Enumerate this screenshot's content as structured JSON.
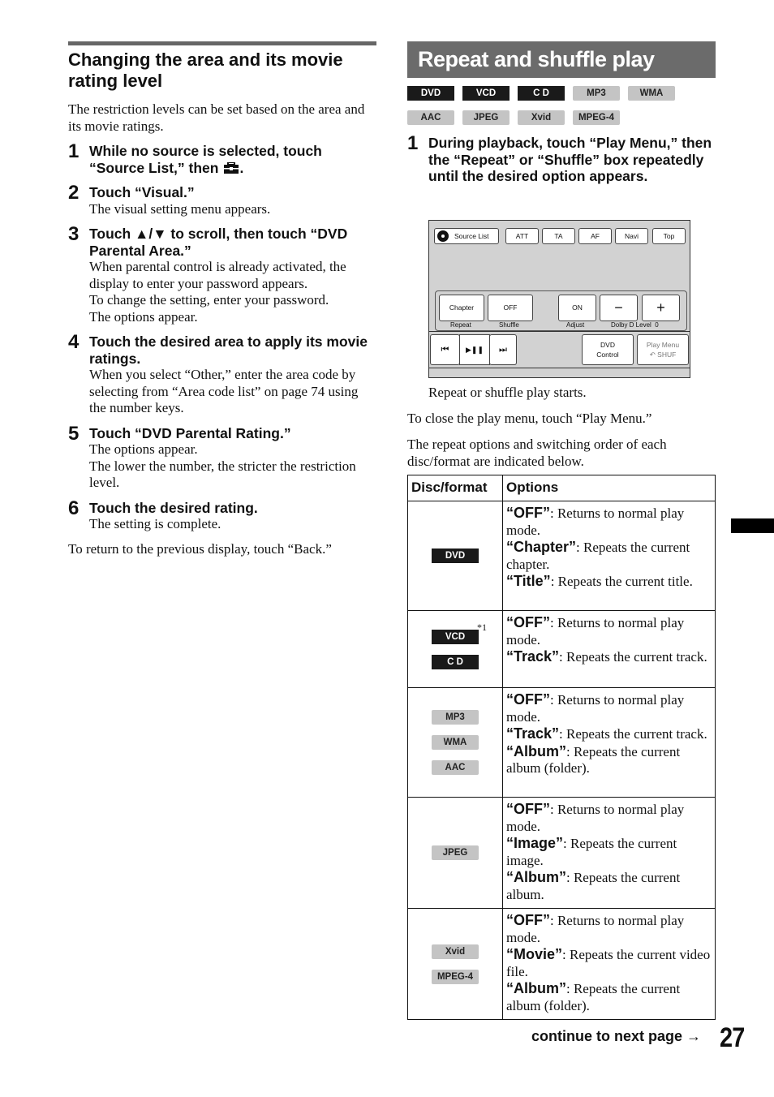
{
  "left": {
    "title": "Changing the area and its movie rating level",
    "intro": "The restriction levels can be set based on the area and its movie ratings.",
    "steps": [
      {
        "num": "1",
        "title": "While no source is selected, touch “Source List,” then",
        "title_icon": "toolbox-icon",
        "title_end": ".",
        "body": []
      },
      {
        "num": "2",
        "title": "Touch “Visual.”",
        "body": [
          "The visual setting menu appears."
        ]
      },
      {
        "num": "3",
        "title": "Touch ▲/▼ to scroll, then touch “DVD Parental Area.”",
        "body": [
          "When parental control is already activated, the display to enter your password appears.",
          "To change the setting, enter your password.",
          "The options appear."
        ]
      },
      {
        "num": "4",
        "title": "Touch the desired area to apply its movie ratings.",
        "body": [
          "When you select “Other,” enter the area code by selecting from “Area code list” on page 74 using the number keys."
        ]
      },
      {
        "num": "5",
        "title": "Touch “DVD Parental Rating.”",
        "body": [
          "The options appear.",
          "The lower the number, the stricter the restriction level."
        ]
      },
      {
        "num": "6",
        "title": "Touch the desired rating.",
        "body": [
          "The setting is complete."
        ]
      }
    ],
    "note": "To return to the previous display, touch “Back.”"
  },
  "right": {
    "banner": "Repeat and shuffle play",
    "badges": [
      {
        "label": "DVD",
        "style": "dark"
      },
      {
        "label": "VCD",
        "style": "dark"
      },
      {
        "label": "C D",
        "style": "dark"
      },
      {
        "label": "MP3",
        "style": "light"
      },
      {
        "label": "WMA",
        "style": "light"
      },
      {
        "label": "AAC",
        "style": "light"
      },
      {
        "label": "JPEG",
        "style": "light"
      },
      {
        "label": "Xvid",
        "style": "light"
      },
      {
        "label": "MPEG-4",
        "style": "light"
      }
    ],
    "step1": {
      "num": "1",
      "title": "During playback, touch “Play Menu,” then the “Repeat” or “Shuffle” box repeatedly until the desired option appears."
    },
    "screen": {
      "top_buttons": [
        "Source List",
        "ATT",
        "TA",
        "AF",
        "Navi",
        "Top"
      ],
      "repeat_value": "Chapter",
      "repeat_label": "Repeat",
      "shuffle_value": "OFF",
      "shuffle_label": "Shuffle",
      "adjust_value": "ON",
      "adjust_label": "Adjust",
      "minus": "−",
      "plus": "+",
      "dolby_label": "Dolby D Level  0",
      "prev": "⏮",
      "playpause": "▶❚❚",
      "next": "⏭",
      "dvd_control": [
        "DVD",
        "Control"
      ],
      "play_menu": [
        "Play Menu",
        "↶ SHUF"
      ]
    },
    "caption": "Repeat or shuffle play starts.",
    "close_note": "To close the play menu, touch “Play Menu.”",
    "order_note": "The repeat options and switching order of each disc/format are indicated below.",
    "table": {
      "headers": [
        "Disc/format",
        "Options"
      ],
      "rows": [
        {
          "formats": [
            {
              "label": "DVD",
              "style": "dark"
            }
          ],
          "options": [
            {
              "key": "“OFF”",
              "desc": ": Returns to normal play mode."
            },
            {
              "key": "“Chapter”",
              "desc": ": Repeats the current chapter."
            },
            {
              "key": "“Title”",
              "desc": ": Repeats the current title."
            }
          ]
        },
        {
          "formats": [
            {
              "label": "VCD",
              "style": "dark"
            },
            {
              "label": "C D",
              "style": "dark"
            }
          ],
          "footnote": "*1",
          "options": [
            {
              "key": "“OFF”",
              "desc": ": Returns to normal play mode."
            },
            {
              "key": "“Track”",
              "desc": ": Repeats the current track."
            }
          ]
        },
        {
          "formats": [
            {
              "label": "MP3",
              "style": "light"
            },
            {
              "label": "WMA",
              "style": "light"
            },
            {
              "label": "AAC",
              "style": "light"
            }
          ],
          "options": [
            {
              "key": "“OFF”",
              "desc": ": Returns to normal play mode."
            },
            {
              "key": "“Track”",
              "desc": ": Repeats the current track."
            },
            {
              "key": "“Album”",
              "desc": ": Repeats the current album (folder)."
            }
          ]
        },
        {
          "formats": [
            {
              "label": "JPEG",
              "style": "light"
            }
          ],
          "options": [
            {
              "key": "“OFF”",
              "desc": ": Returns to normal play mode."
            },
            {
              "key": "“Image”",
              "desc": ": Repeats the current image."
            },
            {
              "key": "“Album”",
              "desc": ": Repeats the current album."
            }
          ]
        },
        {
          "formats": [
            {
              "label": "Xvid",
              "style": "light"
            },
            {
              "label": "MPEG-4",
              "style": "light"
            }
          ],
          "options": [
            {
              "key": "“OFF”",
              "desc": ": Returns to normal play mode."
            },
            {
              "key": "“Movie”",
              "desc": ": Repeats the current video file."
            },
            {
              "key": "“Album”",
              "desc": ": Repeats the current album (folder)."
            }
          ]
        }
      ]
    }
  },
  "footer": {
    "continue": "continue to next page →",
    "page_number": "27"
  }
}
